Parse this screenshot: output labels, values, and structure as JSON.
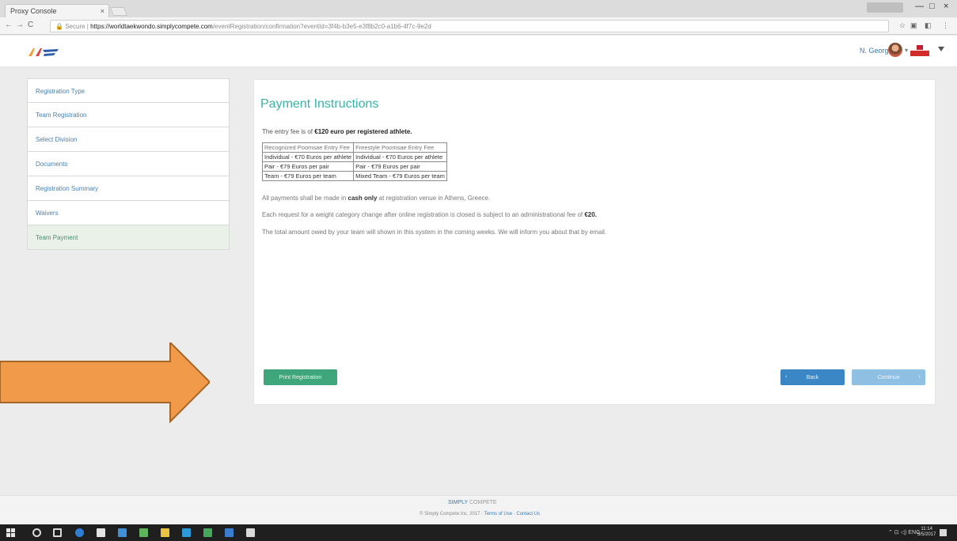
{
  "browser": {
    "tab_title": "Proxy Console",
    "tab_close": "×",
    "back": "←",
    "forward": "→",
    "reload": "C",
    "secure_label": "Secure",
    "url_host": "https://worldtaekwondo.simplycompete.com",
    "url_path": "/eventRegistration/confirmation?eventId=3f4b-b3e5-e3f8b2c0-a1b6-4f7c-9e2d",
    "minimize": "—",
    "maximize": "□",
    "close": "×"
  },
  "header": {
    "username": "N. Georgiu",
    "caret": "▾",
    "menu_caret": "▾"
  },
  "sidebar": {
    "items": [
      {
        "label": "Registration Type",
        "active": false
      },
      {
        "label": "Team Registration",
        "active": false
      },
      {
        "label": "Select Division",
        "active": false
      },
      {
        "label": "Documents",
        "active": false
      },
      {
        "label": "Registration Summary",
        "active": false
      },
      {
        "label": "Waivers",
        "active": false
      },
      {
        "label": "Team Payment",
        "active": true
      }
    ]
  },
  "main": {
    "title": "Payment Instructions",
    "entry_prefix": "The entry fee is of",
    "entry_bold": "€120 euro per registered athlete.",
    "fees_table": {
      "headers": [
        "Recognized Poomsae Entry Fee",
        "Freestyle Poomsae Entry Fee"
      ],
      "rows": [
        [
          "Individual - €70 Euros per athlete",
          "Individual - €70 Euros per athlete"
        ],
        [
          "Pair - €79 Euros per pair",
          "Pair - €79 Euros per pair"
        ],
        [
          "Team - €79 Euros per team",
          "Mixed Team - €79 Euros per team"
        ]
      ]
    },
    "line1_prefix": "All payments shall be made in",
    "line1_bold": "cash only",
    "line1_suffix": "at registration venue in Athens, Greece.",
    "line2_prefix": "Each request for a weight category change after online registration is closed is subject to an administrational fee of",
    "line2_bold": "€20.",
    "line3": "The total amount owed by your team will shown in this system in the coming weeks. We will inform you about that by email.",
    "buttons": {
      "print": "Print Registration",
      "back_icon": "‹",
      "back": "Back",
      "continue": "Continue",
      "continue_icon": "›"
    }
  },
  "footer": {
    "logo": "SIMPLY",
    "powered": "COMPETE",
    "copyright": "© Simply Compete Inc. 2017 ·",
    "terms": "Terms of Use",
    "sep": " · ",
    "contact": "Contact Us"
  },
  "taskbar": {
    "tray": "⌃ ⊡ ◁) ENG",
    "time": "11:14",
    "date": "5/5/2017"
  },
  "colors": {
    "accent_teal": "#38b4a7",
    "print_green": "#3ea67a",
    "back_blue": "#3b87c6",
    "continue_blue": "#90bfe4",
    "arrow_orange": "#f19a4a"
  }
}
